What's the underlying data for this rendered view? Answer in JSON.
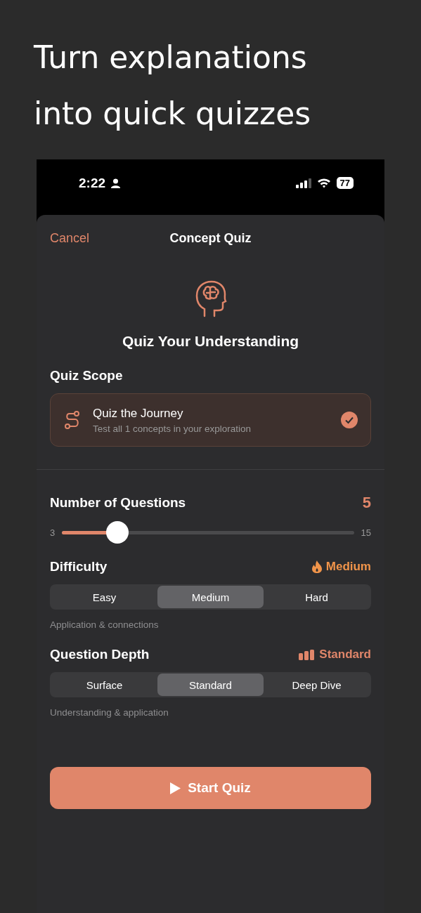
{
  "headline": [
    "Turn explanations",
    "into quick quizzes"
  ],
  "status_bar": {
    "time": "2:22",
    "battery": "77"
  },
  "nav": {
    "cancel": "Cancel",
    "title": "Concept Quiz"
  },
  "hero_title": "Quiz Your Understanding",
  "scope": {
    "heading": "Quiz Scope",
    "options": [
      {
        "title": "Quiz the Journey",
        "subtitle": "Test all 1 concepts in your exploration",
        "selected": true
      }
    ]
  },
  "questions": {
    "heading": "Number of Questions",
    "value": "5",
    "min": "3",
    "max": "15",
    "level": 0.19
  },
  "difficulty": {
    "heading": "Difficulty",
    "badge": "Medium",
    "caption": "Application & connections",
    "options": [
      {
        "label": "Easy",
        "selected": false
      },
      {
        "label": "Medium",
        "selected": true
      },
      {
        "label": "Hard",
        "selected": false
      }
    ]
  },
  "depth": {
    "heading": "Question Depth",
    "badge": "Standard",
    "caption": "Understanding & application",
    "options": [
      {
        "label": "Surface",
        "selected": false
      },
      {
        "label": "Standard",
        "selected": true
      },
      {
        "label": "Deep Dive",
        "selected": false
      }
    ]
  },
  "start_button": "Start Quiz"
}
